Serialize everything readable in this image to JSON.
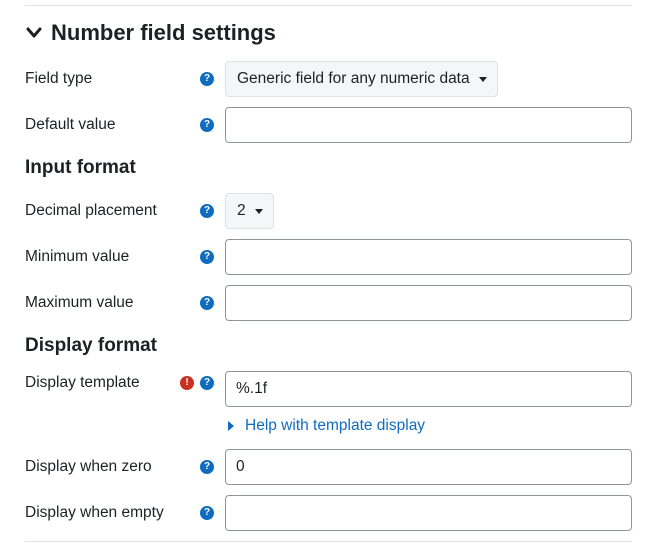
{
  "section": {
    "title": "Number field settings"
  },
  "fields": {
    "field_type": {
      "label": "Field type",
      "selected": "Generic field for any numeric data"
    },
    "default_value": {
      "label": "Default value",
      "value": ""
    }
  },
  "input_format": {
    "heading": "Input format",
    "decimal_placement": {
      "label": "Decimal placement",
      "selected": "2"
    },
    "minimum_value": {
      "label": "Minimum value",
      "value": ""
    },
    "maximum_value": {
      "label": "Maximum value",
      "value": ""
    }
  },
  "display_format": {
    "heading": "Display format",
    "display_template": {
      "label": "Display template",
      "value": "%.1f",
      "help_link": "Help with template display"
    },
    "display_when_zero": {
      "label": "Display when zero",
      "value": "0"
    },
    "display_when_empty": {
      "label": "Display when empty",
      "value": ""
    }
  },
  "icons": {
    "help": "question-circle-icon",
    "required": "exclamation-circle-icon",
    "collapse": "chevron-down-icon"
  },
  "colors": {
    "accent": "#0f6cbf",
    "required": "#ca3120",
    "text": "#1d2125",
    "border": "#8f959e"
  }
}
